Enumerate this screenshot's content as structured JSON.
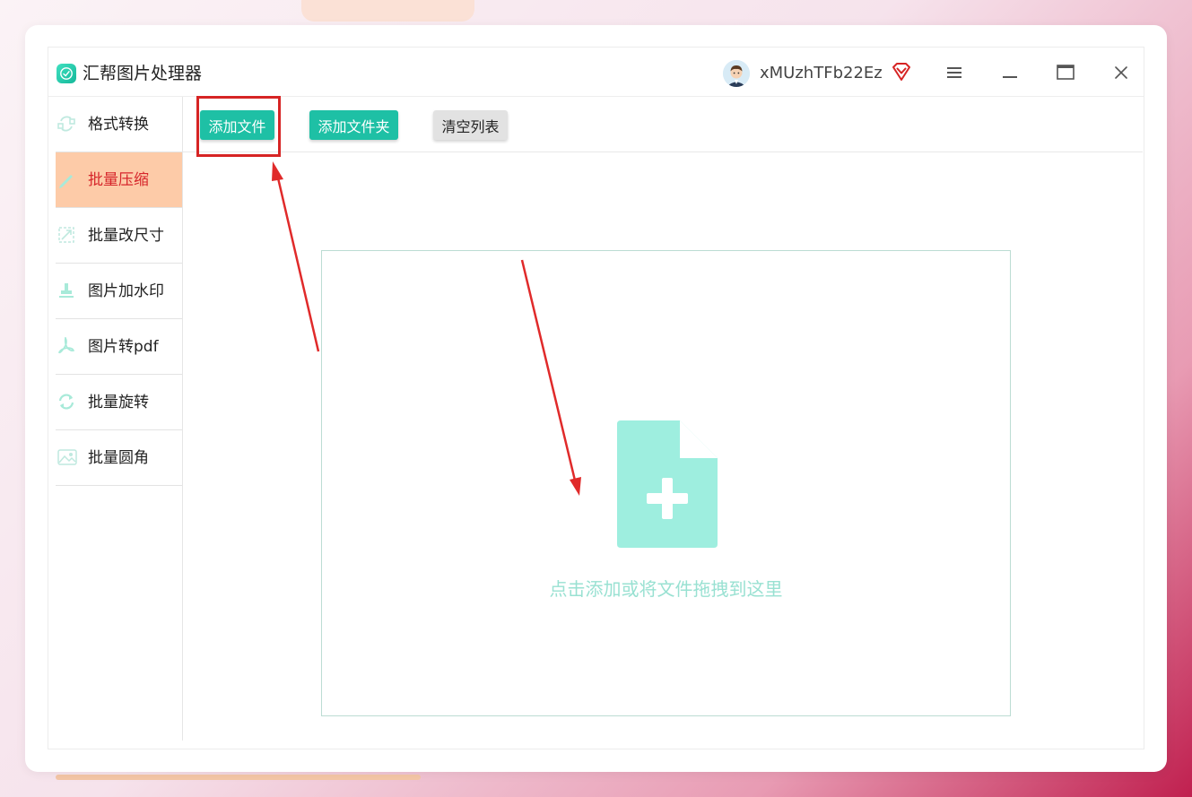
{
  "app": {
    "title": "汇帮图片处理器"
  },
  "user": {
    "name": "xMUzhTFb22Ez"
  },
  "sidebar": {
    "items": [
      {
        "label": "格式转换",
        "icon": "format-convert-icon"
      },
      {
        "label": "批量压缩",
        "icon": "compress-icon",
        "active": true
      },
      {
        "label": "批量改尺寸",
        "icon": "resize-icon"
      },
      {
        "label": "图片加水印",
        "icon": "watermark-icon"
      },
      {
        "label": "图片转pdf",
        "icon": "pdf-icon"
      },
      {
        "label": "批量旋转",
        "icon": "rotate-icon"
      },
      {
        "label": "批量圆角",
        "icon": "round-corner-icon"
      }
    ]
  },
  "toolbar": {
    "add_file": "添加文件",
    "add_folder": "添加文件夹",
    "clear_list": "清空列表"
  },
  "dropzone": {
    "hint": "点击添加或将文件拖拽到这里"
  },
  "colors": {
    "accent": "#1ec0a5",
    "active_nav_bg": "#fdcba8",
    "active_nav_text": "#d6262b",
    "annotation_red": "#d62424",
    "drop_icon": "#9eeedf"
  }
}
